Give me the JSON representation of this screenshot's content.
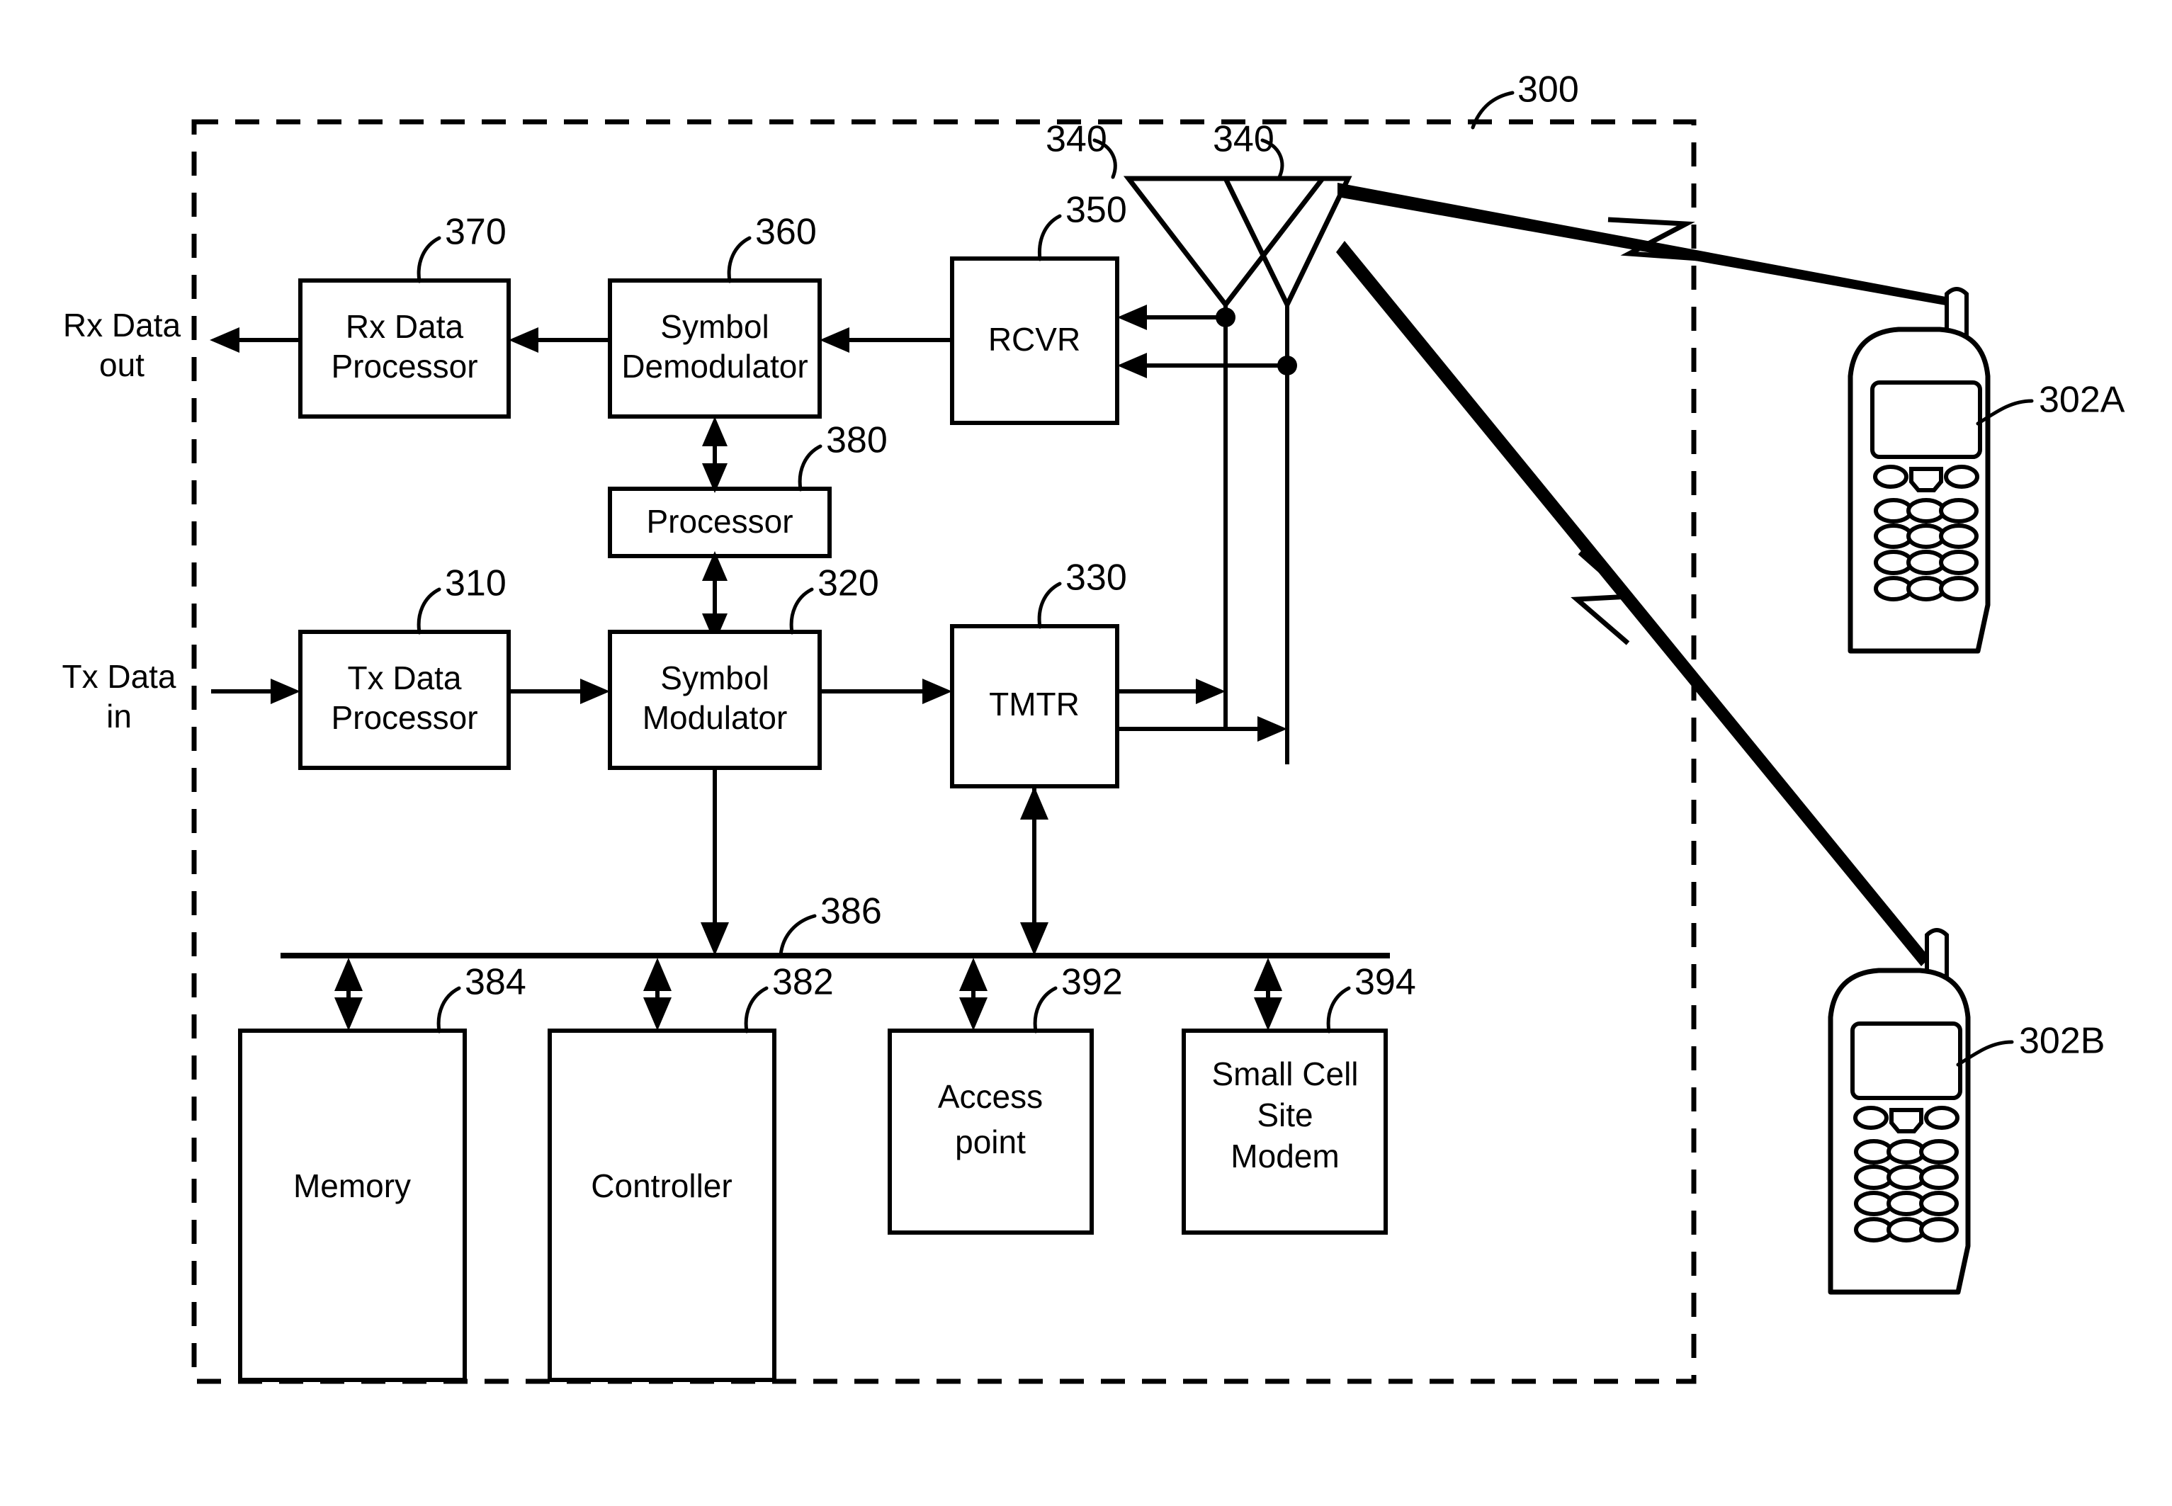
{
  "figure": {
    "boundary_ref": "300",
    "blocks": [
      {
        "id": "rx_data_processor",
        "ref": "370",
        "lines": [
          "Rx Data",
          "Processor"
        ]
      },
      {
        "id": "symbol_demodulator",
        "ref": "360",
        "lines": [
          "Symbol",
          "Demodulator"
        ]
      },
      {
        "id": "rcvr",
        "ref": "350",
        "lines": [
          "RCVR"
        ]
      },
      {
        "id": "processor",
        "ref": "380",
        "lines": [
          "Processor"
        ]
      },
      {
        "id": "tx_data_processor",
        "ref": "310",
        "lines": [
          "Tx Data",
          "Processor"
        ]
      },
      {
        "id": "symbol_modulator",
        "ref": "320",
        "lines": [
          "Symbol",
          "Modulator"
        ]
      },
      {
        "id": "tmtr",
        "ref": "330",
        "lines": [
          "TMTR"
        ]
      },
      {
        "id": "memory",
        "ref": "384",
        "lines": [
          "Memory"
        ]
      },
      {
        "id": "controller",
        "ref": "382",
        "lines": [
          "Controller"
        ]
      },
      {
        "id": "access_point",
        "ref": "392",
        "lines": [
          "Access",
          "point"
        ]
      },
      {
        "id": "small_cell_site_modem",
        "ref": "394",
        "lines": [
          "Small Cell",
          "Site",
          "Modem"
        ]
      }
    ],
    "bus": {
      "ref": "386"
    },
    "antennas": [
      {
        "id": "antenna_left",
        "ref": "340"
      },
      {
        "id": "antenna_right",
        "ref": "340"
      }
    ],
    "io_labels": [
      {
        "id": "rx_data_out",
        "lines": [
          "Rx Data",
          "out"
        ]
      },
      {
        "id": "tx_data_in",
        "lines": [
          "Tx Data",
          "in"
        ]
      }
    ],
    "terminals": [
      {
        "id": "terminal_a",
        "ref": "302A"
      },
      {
        "id": "terminal_b",
        "ref": "302B"
      }
    ],
    "colors": {
      "ink": "#000000",
      "paper": "#ffffff"
    }
  }
}
